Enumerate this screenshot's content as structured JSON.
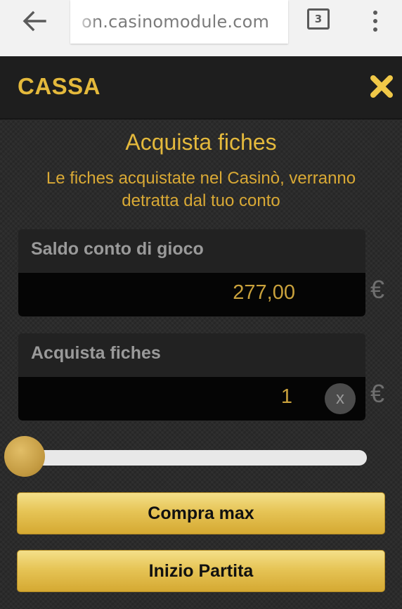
{
  "browser": {
    "url": "on.casinomodule.com",
    "tab_count": "3",
    "icons": [
      "back-arrow-icon",
      "tabs-icon",
      "more-vert-icon"
    ]
  },
  "cashier": {
    "title": "CASSA",
    "close_icon": "close-x-icon",
    "section_title": "Acquista fiches",
    "description": "Le fiches acquistate nel Casinò, verranno detratta dal tuo conto",
    "balance": {
      "label": "Saldo conto di gioco",
      "value": "277,00",
      "currency": "€"
    },
    "purchase": {
      "label": "Acquista fiches",
      "value": "1",
      "clear_label": "x",
      "currency": "€"
    },
    "slider": {
      "min": 1,
      "max": 277,
      "value": 1
    },
    "buttons": {
      "buy_max": "Compra max",
      "start_game": "Inizio Partita"
    },
    "colors": {
      "accent": "#e4b93c",
      "background": "#2b2b2b",
      "button_gold": "#e6c456"
    }
  }
}
